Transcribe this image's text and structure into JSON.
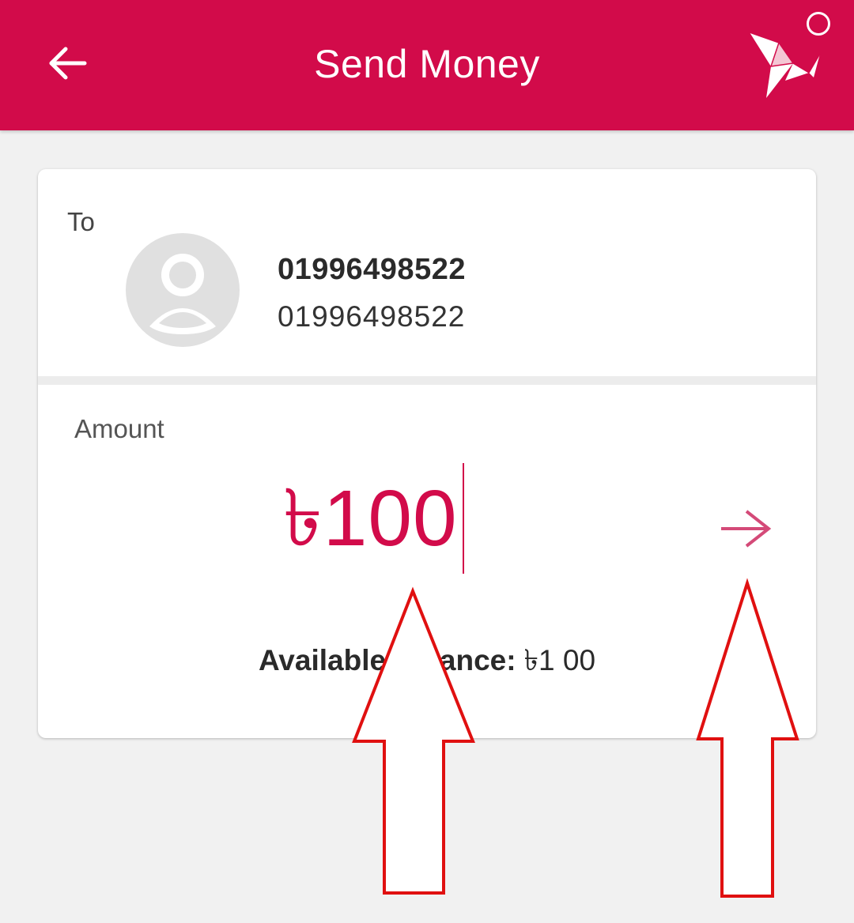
{
  "header": {
    "title": "Send Money",
    "back_icon": "arrow-left-icon",
    "logo_icon": "origami-bird-logo",
    "bg_color": "#d20b4a"
  },
  "recipient": {
    "section_label": "To",
    "name": "01996498522",
    "number": "01996498522",
    "avatar_icon": "person-icon"
  },
  "amount": {
    "section_label": "Amount",
    "value": "৳100",
    "next_icon": "arrow-right-icon"
  },
  "balance": {
    "label": "Available Balance:",
    "value": "৳1  00"
  },
  "annotations": {
    "arrow_color": "#e01010",
    "arrow_icon": "up-arrow-annotation"
  }
}
